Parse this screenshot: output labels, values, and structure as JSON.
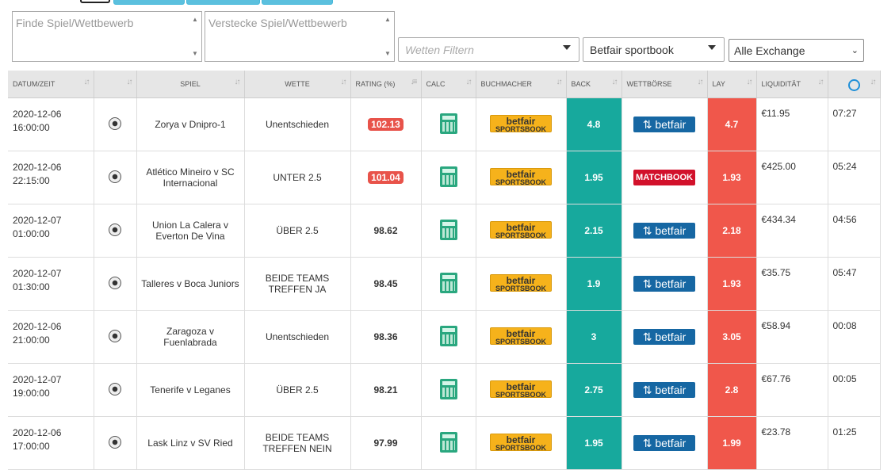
{
  "filters": {
    "find_placeholder": "Finde Spiel/Wettbewerb",
    "hide_placeholder": "Verstecke Spiel/Wettbewerb",
    "bets_filter": "Wetten Filtern",
    "bookmaker_select": "Betfair sportbook",
    "exchange_select": "Alle Exchange"
  },
  "columns": {
    "datetime": "DATUM/ZEIT",
    "game": "SPIEL",
    "bet": "WETTE",
    "rating": "RATING (%)",
    "calc": "CALC",
    "bookmaker": "BUCHMACHER",
    "back": "BACK",
    "exchange": "WETTBÖRSE",
    "lay": "LAY",
    "liquidity": "LIQUIDITÄT"
  },
  "logos": {
    "betfair_sb_line1": "betfair",
    "betfair_sb_line2": "SPORTSBOOK",
    "betfair_ex": "betfair",
    "matchbook": "MATCHBOOK"
  },
  "rows": [
    {
      "date": "2020-12-06",
      "time": "16:00:00",
      "game": "Zorya v Dnipro-1",
      "bet": "Unentschieden",
      "rating": "102.13",
      "high": true,
      "back": "4.8",
      "exchange": "betfair",
      "lay": "4.7",
      "liq": "€11.95",
      "remain": "07:27"
    },
    {
      "date": "2020-12-06",
      "time": "22:15:00",
      "game": "Atlético Mineiro v SC Internacional",
      "bet": "UNTER 2.5",
      "rating": "101.04",
      "high": true,
      "back": "1.95",
      "exchange": "matchbook",
      "lay": "1.93",
      "liq": "€425.00",
      "remain": "05:24"
    },
    {
      "date": "2020-12-07",
      "time": "01:00:00",
      "game": "Union La Calera v Everton De Vina",
      "bet": "ÜBER 2.5",
      "rating": "98.62",
      "high": false,
      "back": "2.15",
      "exchange": "betfair",
      "lay": "2.18",
      "liq": "€434.34",
      "remain": "04:56"
    },
    {
      "date": "2020-12-07",
      "time": "01:30:00",
      "game": "Talleres v Boca Juniors",
      "bet": "BEIDE TEAMS TREFFEN JA",
      "rating": "98.45",
      "high": false,
      "back": "1.9",
      "exchange": "betfair",
      "lay": "1.93",
      "liq": "€35.75",
      "remain": "05:47"
    },
    {
      "date": "2020-12-06",
      "time": "21:00:00",
      "game": "Zaragoza v Fuenlabrada",
      "bet": "Unentschieden",
      "rating": "98.36",
      "high": false,
      "back": "3",
      "exchange": "betfair",
      "lay": "3.05",
      "liq": "€58.94",
      "remain": "00:08"
    },
    {
      "date": "2020-12-07",
      "time": "19:00:00",
      "game": "Tenerife v Leganes",
      "bet": "ÜBER 2.5",
      "rating": "98.21",
      "high": false,
      "back": "2.75",
      "exchange": "betfair",
      "lay": "2.8",
      "liq": "€67.76",
      "remain": "00:05"
    },
    {
      "date": "2020-12-06",
      "time": "17:00:00",
      "game": "Lask Linz v SV Ried",
      "bet": "BEIDE TEAMS TREFFEN NEIN",
      "rating": "97.99",
      "high": false,
      "back": "1.95",
      "exchange": "betfair",
      "lay": "1.99",
      "liq": "€23.78",
      "remain": "01:25"
    }
  ],
  "colors": {
    "back": "#17a99d",
    "lay": "#f0574b",
    "rating_high": "#e8534a"
  }
}
